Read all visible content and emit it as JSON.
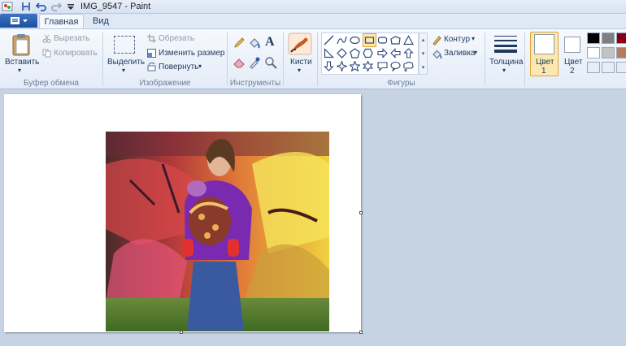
{
  "title": "IMG_9547 - Paint",
  "tabs": {
    "home": "Главная",
    "view": "Вид"
  },
  "clipboard": {
    "paste": "Вставить",
    "cut": "Вырезать",
    "copy": "Копировать",
    "group": "Буфер обмена"
  },
  "image": {
    "select": "Выделить",
    "crop": "Обрезать",
    "resize": "Изменить размер",
    "rotate": "Повернуть",
    "group": "Изображение"
  },
  "tools": {
    "group": "Инструменты"
  },
  "brushes": {
    "label": "Кисти"
  },
  "shapes": {
    "group": "Фигуры",
    "outline": "Контур",
    "fill": "Заливка"
  },
  "size": {
    "label": "Толщина"
  },
  "colors": {
    "color1": "Цвет",
    "color1_num": "1",
    "color2": "Цвет",
    "color2_num": "2",
    "palette": [
      "#000000",
      "#7f7f7f",
      "#880015",
      "#ffffff",
      "#c3c3c3",
      "#b97a57"
    ]
  },
  "icons": [
    "paint-app-icon",
    "save-icon",
    "undo-icon",
    "redo-icon",
    "qa-dropdown-icon",
    "file-menu-icon",
    "paste-icon",
    "cut-icon",
    "copy-icon",
    "select-icon",
    "crop-icon",
    "resize-icon",
    "rotate-icon",
    "pencil-icon",
    "fill-icon",
    "text-icon",
    "eraser-icon",
    "color-picker-icon",
    "magnifier-icon",
    "brush-icon",
    "size-icon"
  ]
}
